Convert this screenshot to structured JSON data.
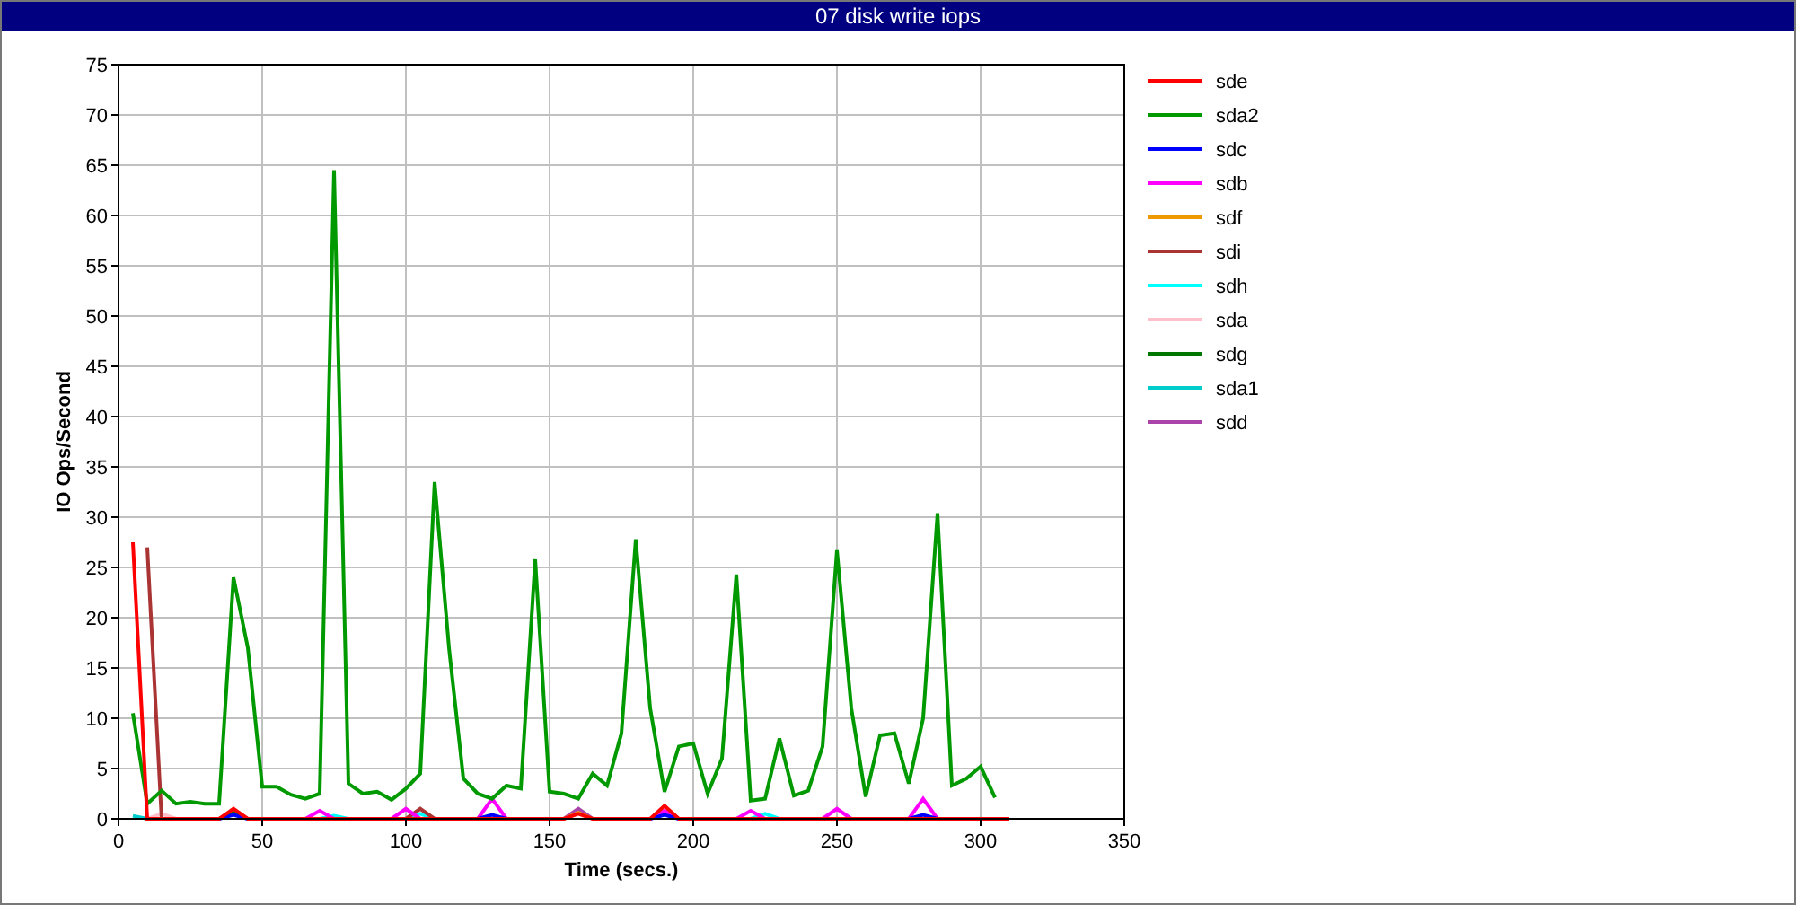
{
  "chart_data": {
    "type": "line",
    "title": "07 disk write iops",
    "xlabel": "Time (secs.)",
    "ylabel": "IO Ops/Second",
    "x": [
      5,
      10,
      15,
      20,
      25,
      30,
      35,
      40,
      45,
      50,
      55,
      60,
      65,
      70,
      75,
      80,
      85,
      90,
      95,
      100,
      105,
      110,
      115,
      120,
      125,
      130,
      135,
      140,
      145,
      150,
      155,
      160,
      165,
      170,
      175,
      180,
      185,
      190,
      195,
      200,
      205,
      210,
      215,
      220,
      225,
      230,
      235,
      240,
      245,
      250,
      255,
      260,
      265,
      270,
      275,
      280,
      285,
      290,
      295,
      300,
      305,
      310
    ],
    "xlim": [
      0,
      350
    ],
    "ylim": [
      0,
      75
    ],
    "xticks": [
      0,
      50,
      100,
      150,
      200,
      250,
      300,
      350
    ],
    "yticks": [
      0,
      5,
      10,
      15,
      20,
      25,
      30,
      35,
      40,
      45,
      50,
      55,
      60,
      65,
      70,
      75
    ],
    "grid": true,
    "legend": true,
    "series": [
      {
        "name": "sde",
        "color": "#ff0000",
        "values": [
          27.5,
          0,
          0,
          0,
          0,
          0,
          0,
          1,
          0,
          0,
          0,
          0,
          0,
          0,
          0,
          0,
          0,
          0,
          0,
          0,
          0,
          0,
          0,
          0,
          0,
          0,
          0,
          0,
          0,
          0,
          0,
          0.5,
          0,
          0,
          0,
          0,
          0,
          1.3,
          0,
          0,
          0,
          0,
          0,
          0,
          0,
          0,
          0,
          0,
          0,
          0,
          0,
          0,
          0,
          0,
          0,
          0,
          0,
          0,
          0,
          0,
          0,
          0
        ]
      },
      {
        "name": "sda2",
        "color": "#009900",
        "values": [
          10.5,
          1.5,
          2.8,
          1.5,
          1.7,
          1.5,
          1.5,
          24,
          17,
          3.2,
          3.2,
          2.4,
          2,
          2.5,
          64.5,
          3.5,
          2.5,
          2.7,
          1.9,
          3,
          4.5,
          33.5,
          17,
          4,
          2.5,
          2,
          3.3,
          3,
          25.8,
          2.7,
          2.5,
          2,
          4.5,
          3.3,
          8.5,
          27.8,
          11,
          2.7,
          7.2,
          7.5,
          2.5,
          6,
          24.3,
          1.8,
          2,
          8,
          2.3,
          2.8,
          7.2,
          26.7,
          11,
          2.2,
          8.3,
          8.5,
          3.5,
          10,
          30.4,
          3.3,
          4,
          5.2,
          2.1,
          null
        ]
      },
      {
        "name": "sdc",
        "color": "#0000ff",
        "values": [
          null,
          null,
          null,
          null,
          null,
          null,
          0,
          0.4,
          0,
          null,
          null,
          null,
          null,
          null,
          null,
          null,
          null,
          null,
          null,
          null,
          null,
          null,
          null,
          null,
          0,
          0.4,
          0,
          null,
          null,
          null,
          null,
          null,
          null,
          null,
          null,
          null,
          0,
          0.4,
          0,
          null,
          null,
          null,
          null,
          null,
          null,
          null,
          null,
          null,
          null,
          null,
          null,
          null,
          null,
          null,
          0,
          0.4,
          0,
          null,
          null,
          null,
          null,
          null
        ]
      },
      {
        "name": "sdb",
        "color": "#ff00ff",
        "values": [
          null,
          null,
          null,
          null,
          null,
          null,
          null,
          null,
          null,
          null,
          null,
          null,
          0,
          0.8,
          0,
          null,
          null,
          null,
          0,
          1,
          0,
          null,
          null,
          null,
          0,
          2,
          0,
          null,
          null,
          null,
          null,
          null,
          null,
          null,
          null,
          null,
          0,
          0.8,
          0,
          null,
          null,
          null,
          0,
          0.8,
          0,
          null,
          null,
          null,
          0,
          1,
          0,
          null,
          null,
          null,
          0,
          2,
          0,
          null,
          null,
          null,
          null,
          null
        ]
      },
      {
        "name": "sdf",
        "color": "#ee9900",
        "values": [
          null,
          null,
          null,
          null,
          null,
          null,
          null,
          null,
          null,
          null,
          null,
          null,
          null,
          null,
          null,
          null,
          null,
          null,
          null,
          null,
          null,
          null,
          null,
          null,
          null,
          null,
          null,
          null,
          null,
          null,
          0,
          0.6,
          0,
          null,
          null,
          null,
          null,
          null,
          null,
          null,
          null,
          null,
          null,
          null,
          null,
          null,
          null,
          null,
          null,
          null,
          null,
          null,
          null,
          null,
          null,
          null,
          null,
          null,
          null,
          null,
          null,
          null
        ]
      },
      {
        "name": "sdi",
        "color": "#aa3333",
        "values": [
          null,
          27,
          0,
          null,
          null,
          null,
          null,
          null,
          null,
          null,
          null,
          null,
          null,
          null,
          null,
          null,
          null,
          null,
          null,
          0,
          1,
          0,
          null,
          null,
          null,
          null,
          null,
          null,
          null,
          null,
          null,
          null,
          null,
          null,
          null,
          null,
          null,
          null,
          null,
          null,
          null,
          null,
          null,
          null,
          null,
          null,
          null,
          null,
          null,
          null,
          null,
          null,
          null,
          null,
          null,
          null,
          null,
          null,
          null,
          null,
          null,
          null
        ]
      },
      {
        "name": "sdh",
        "color": "#00ffff",
        "values": [
          null,
          null,
          null,
          null,
          null,
          null,
          null,
          null,
          null,
          null,
          null,
          null,
          null,
          0,
          0.3,
          0,
          null,
          null,
          null,
          0,
          0.5,
          0,
          null,
          null,
          null,
          null,
          null,
          null,
          null,
          null,
          null,
          null,
          null,
          null,
          null,
          null,
          null,
          null,
          null,
          null,
          null,
          null,
          null,
          0,
          0.5,
          0,
          null,
          null,
          null,
          null,
          null,
          null,
          null,
          null,
          null,
          null,
          null,
          null,
          null,
          null,
          null,
          null
        ]
      },
      {
        "name": "sda",
        "color": "#ffc0cb",
        "values": [
          null,
          0,
          0.5,
          0,
          null,
          null,
          null,
          null,
          null,
          null,
          null,
          null,
          null,
          null,
          null,
          null,
          null,
          null,
          null,
          null,
          null,
          null,
          null,
          null,
          null,
          null,
          null,
          null,
          null,
          null,
          null,
          null,
          null,
          null,
          null,
          null,
          null,
          null,
          null,
          null,
          null,
          null,
          null,
          null,
          null,
          null,
          null,
          null,
          null,
          null,
          null,
          null,
          null,
          null,
          null,
          null,
          null,
          null,
          null,
          null,
          null,
          null
        ]
      },
      {
        "name": "sdg",
        "color": "#007700",
        "values": [
          null,
          null,
          null,
          null,
          null,
          null,
          0,
          0.6,
          0,
          null,
          null,
          null,
          null,
          null,
          null,
          null,
          null,
          null,
          null,
          null,
          null,
          null,
          null,
          null,
          null,
          null,
          null,
          null,
          null,
          null,
          null,
          null,
          null,
          null,
          null,
          null,
          null,
          null,
          null,
          null,
          null,
          null,
          null,
          null,
          null,
          null,
          null,
          null,
          null,
          null,
          null,
          null,
          null,
          null,
          null,
          null,
          null,
          null,
          null,
          null,
          null,
          null
        ]
      },
      {
        "name": "sda1",
        "color": "#00cccc",
        "values": [
          0.3,
          0,
          null,
          null,
          null,
          null,
          null,
          null,
          null,
          null,
          null,
          null,
          null,
          null,
          null,
          null,
          null,
          null,
          null,
          null,
          null,
          null,
          null,
          null,
          null,
          null,
          null,
          null,
          null,
          null,
          null,
          null,
          null,
          null,
          null,
          null,
          null,
          null,
          null,
          null,
          null,
          null,
          null,
          null,
          null,
          null,
          null,
          null,
          null,
          null,
          null,
          null,
          null,
          null,
          null,
          null,
          null,
          null,
          null,
          null,
          null,
          null
        ]
      },
      {
        "name": "sdd",
        "color": "#aa44aa",
        "values": [
          null,
          null,
          null,
          null,
          null,
          null,
          null,
          null,
          null,
          null,
          null,
          null,
          null,
          null,
          null,
          null,
          null,
          null,
          null,
          null,
          null,
          null,
          null,
          null,
          null,
          null,
          null,
          null,
          null,
          null,
          0,
          1,
          0,
          null,
          null,
          null,
          null,
          null,
          null,
          null,
          null,
          null,
          null,
          null,
          null,
          null,
          null,
          null,
          null,
          null,
          null,
          null,
          null,
          null,
          null,
          null,
          null,
          null,
          null,
          null,
          null,
          null
        ]
      }
    ]
  }
}
